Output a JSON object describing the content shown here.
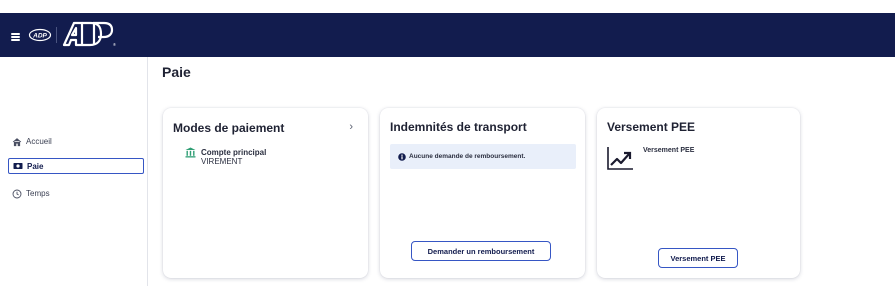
{
  "header": {
    "brand": "ADP",
    "colors": {
      "bar": "#121c4e",
      "accent": "#3656c4"
    }
  },
  "sidebar": {
    "items": [
      {
        "label": "Accueil",
        "icon": "home-icon",
        "active": false
      },
      {
        "label": "Paie",
        "icon": "money-icon",
        "active": true
      },
      {
        "label": "Temps",
        "icon": "clock-icon",
        "active": false
      }
    ]
  },
  "page": {
    "title": "Paie"
  },
  "cards": {
    "payment_modes": {
      "title": "Modes de paiement",
      "chevron": "›",
      "account_name": "Compte principal",
      "account_type": "VIREMENT"
    },
    "transport": {
      "title": "Indemnités de transport",
      "info": "Aucune demande de remboursement.",
      "button": "Demander un remboursement"
    },
    "pee": {
      "title": "Versement PEE",
      "label": "Versement PEE",
      "button": "Versement PEE"
    }
  }
}
